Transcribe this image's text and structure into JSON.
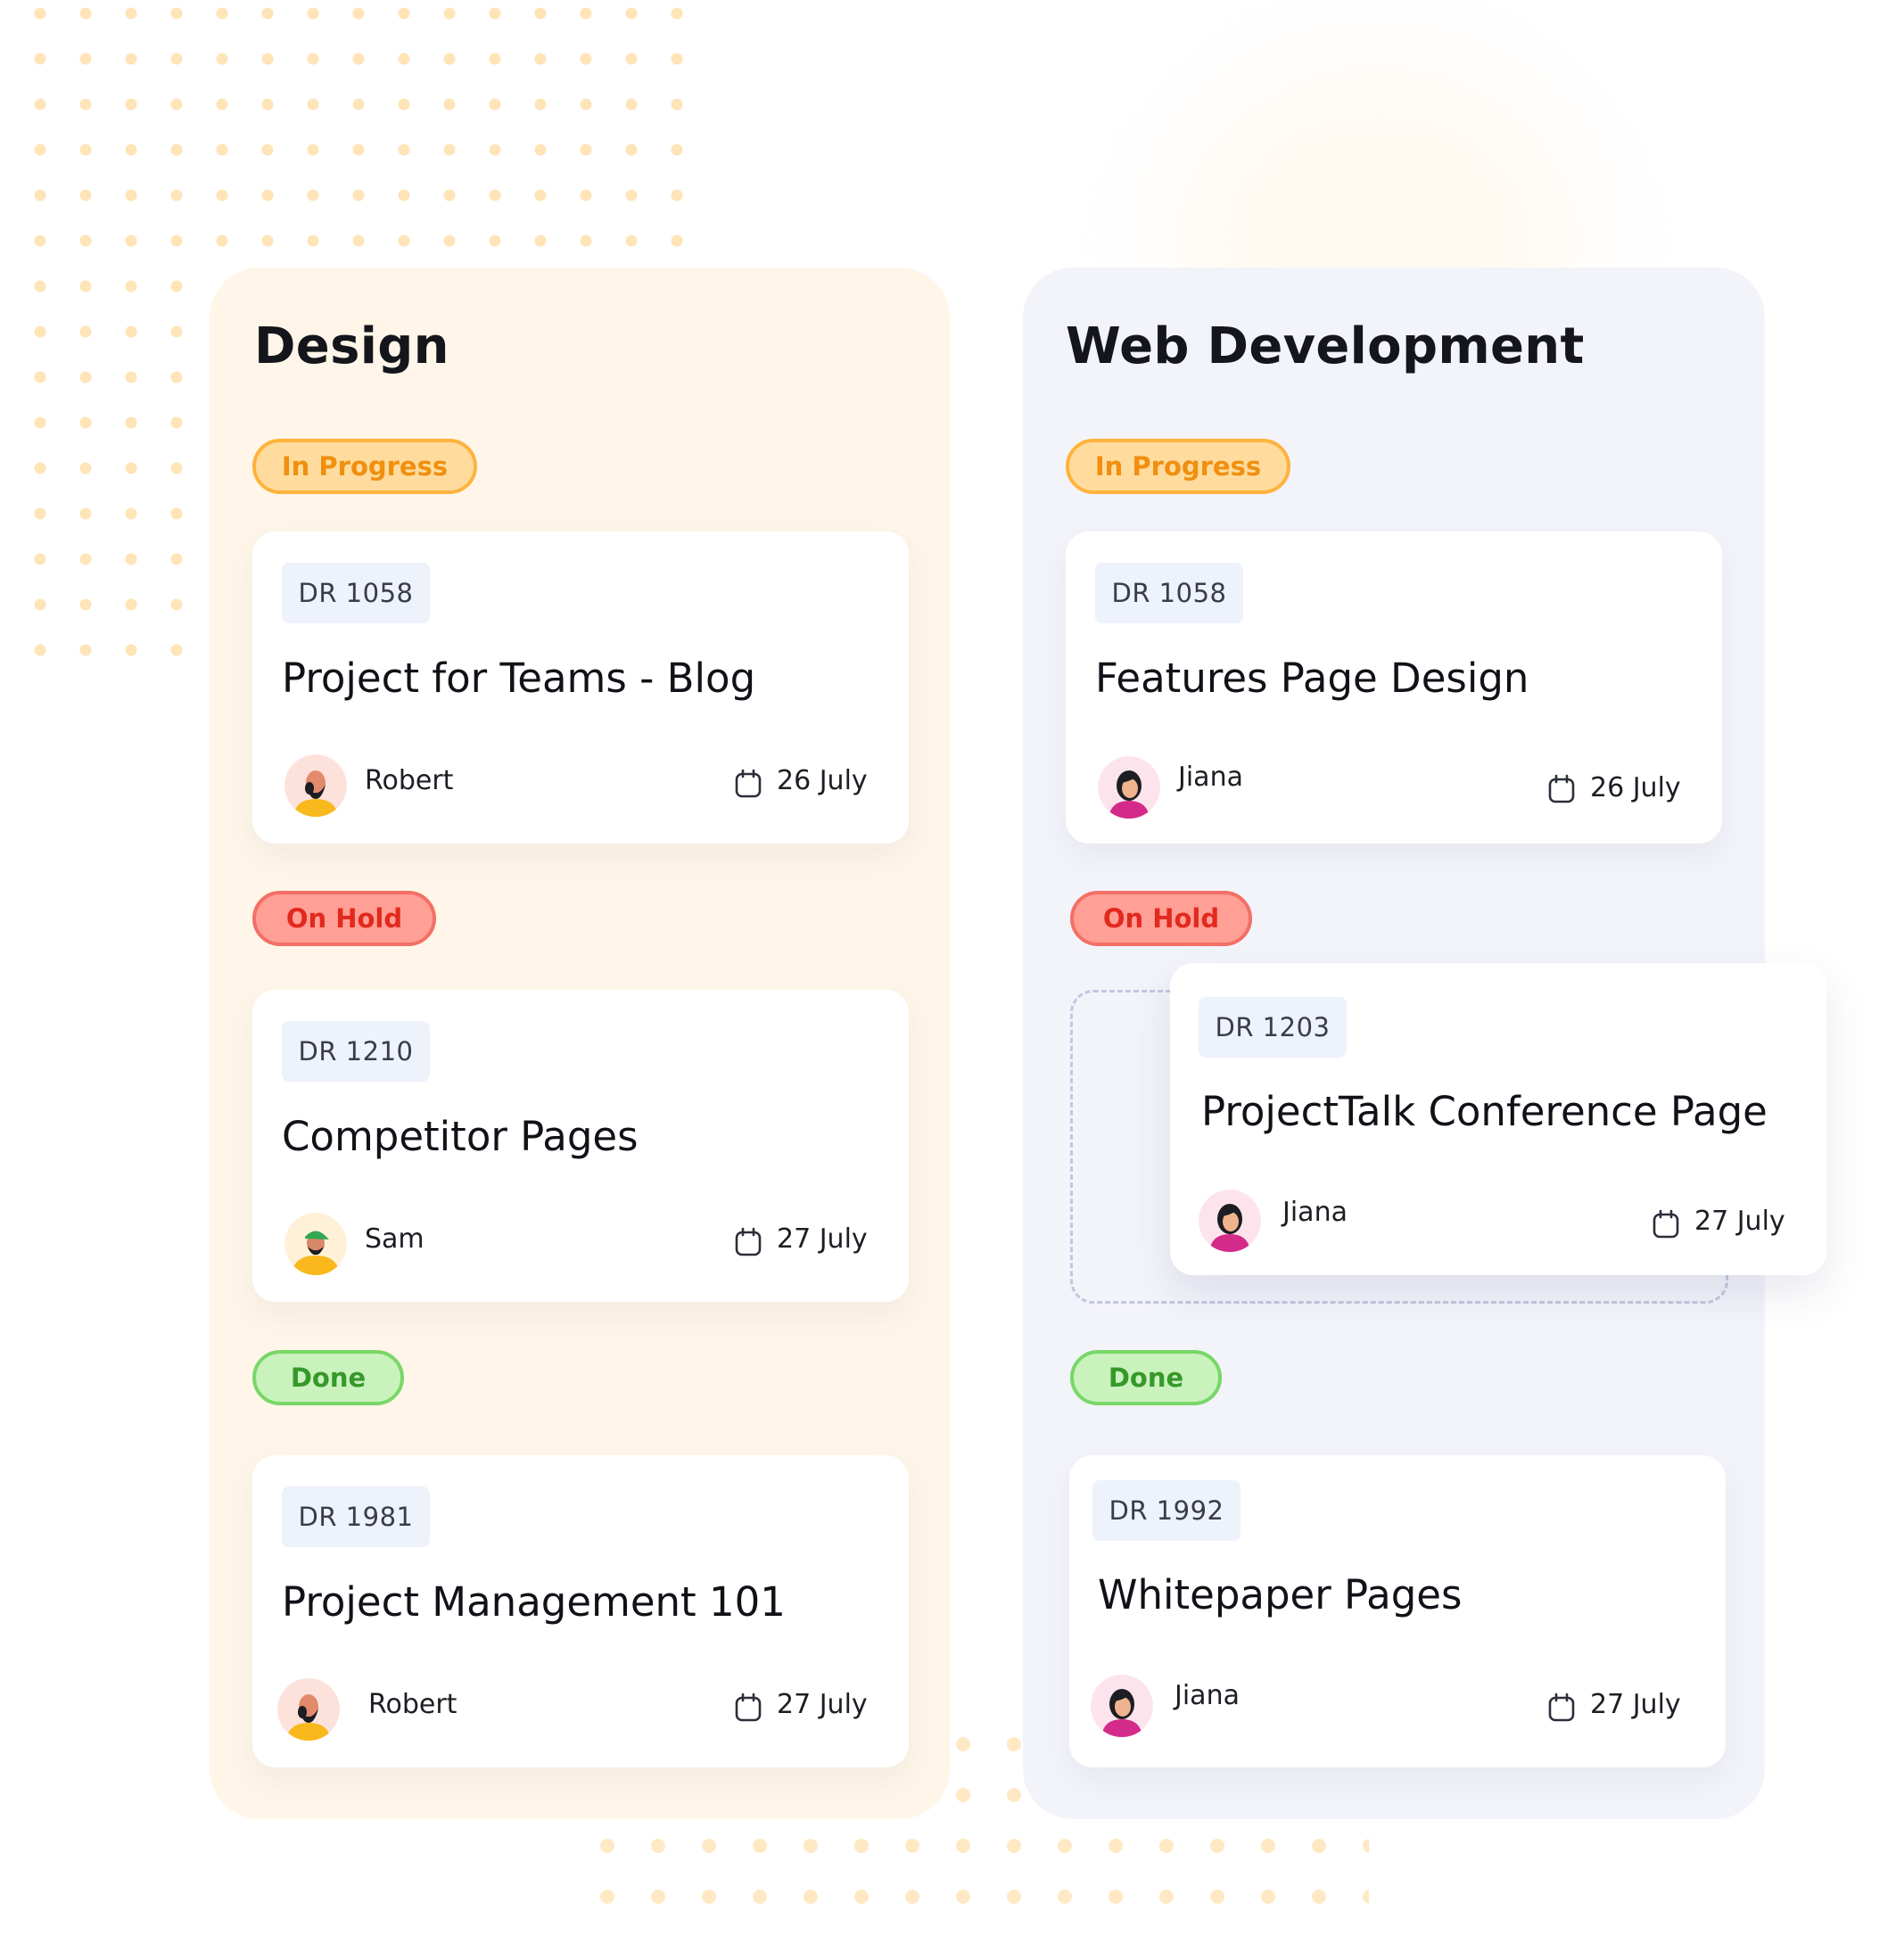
{
  "board": {
    "columns": [
      {
        "name": "Design",
        "groups": [
          {
            "status": "In Progress",
            "tasks": [
              {
                "code": "DR 1058",
                "title": "Project for Teams - Blog",
                "assignee": "Robert",
                "avatar_icon": "man-bald-avatar-icon",
                "date": "26 July"
              }
            ]
          },
          {
            "status": "On Hold",
            "tasks": [
              {
                "code": "DR 1210",
                "title": "Competitor Pages",
                "assignee": "Sam",
                "avatar_icon": "man-cap-avatar-icon",
                "date": "27 July"
              }
            ]
          },
          {
            "status": "Done",
            "tasks": [
              {
                "code": "DR 1981",
                "title": "Project Management 101",
                "assignee": "Robert",
                "avatar_icon": "man-bald-avatar-icon",
                "date": "27 July"
              }
            ]
          }
        ]
      },
      {
        "name": "Web Development",
        "groups": [
          {
            "status": "In Progress",
            "tasks": [
              {
                "code": "DR 1058",
                "title": "Features Page Design",
                "assignee": "Jiana",
                "avatar_icon": "woman-avatar-icon",
                "date": "26 July"
              }
            ]
          },
          {
            "status": "On Hold",
            "tasks": [
              {
                "code": "DR 1203",
                "title": "ProjectTalk Conference Page",
                "assignee": "Jiana",
                "avatar_icon": "woman-avatar-icon",
                "date": "27 July",
                "dragging": true
              }
            ]
          },
          {
            "status": "Done",
            "tasks": [
              {
                "code": "DR 1992",
                "title": "Whitepaper Pages",
                "assignee": "Jiana",
                "avatar_icon": "woman-avatar-icon",
                "date": "27 July"
              }
            ]
          }
        ]
      }
    ]
  },
  "icons": {
    "date": "calendar-icon"
  },
  "colors": {
    "in_progress": "#ffb23c",
    "on_hold": "#f46f66",
    "done": "#78d768",
    "design_column_bg": "#fff6e9",
    "web_column_bg": "#f3f3fa",
    "decor_dots": "#ffe4b8"
  }
}
